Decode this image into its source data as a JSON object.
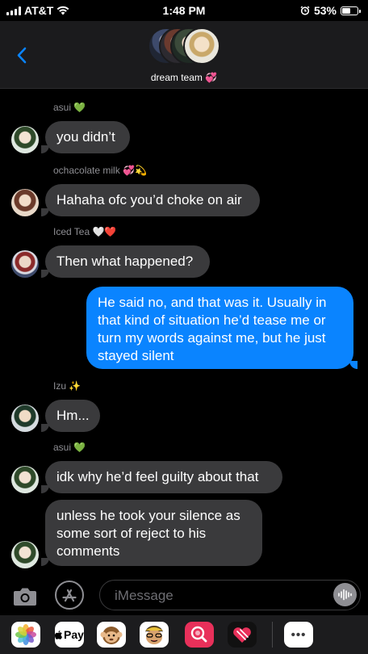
{
  "status_bar": {
    "carrier": "AT&T",
    "time": "1:48 PM",
    "battery": "53%",
    "battery_level": 0.53
  },
  "header": {
    "back_icon": "chevron-left-icon",
    "group_name": "dream team 💞"
  },
  "messages": [
    {
      "sender": "asui 💚",
      "text": "you didn’t",
      "direction": "incoming"
    },
    {
      "sender": "ochacolate milk 💞💫",
      "text": "Hahaha ofc you’d choke on air",
      "direction": "incoming"
    },
    {
      "sender": "Iced Tea 🤍❤️",
      "text": "Then what happened?",
      "direction": "incoming"
    },
    {
      "text": "He said no, and that was it. Usually in that kind of situation he’d tease me or turn my words against me, but he just stayed silent",
      "direction": "outgoing"
    },
    {
      "sender": "Izu ✨",
      "text": "Hm...",
      "direction": "incoming"
    },
    {
      "sender": "asui 💚",
      "text": "idk why he’d feel guilty about that",
      "direction": "incoming"
    },
    {
      "text": "unless he took your silence as some sort of reject to his comments",
      "direction": "incoming"
    }
  ],
  "input_bar": {
    "placeholder": "iMessage",
    "value": ""
  },
  "app_drawer": {
    "apps": [
      "photos-icon",
      "apple-pay-icon",
      "memoji-icon",
      "memoji-stickers-icon",
      "web-images-icon",
      "digital-touch-icon",
      "more-icon"
    ],
    "apple_pay_label": "Pay",
    "more_label": "•••"
  },
  "colors": {
    "background": "#000000",
    "incoming_bubble": "#3a3a3c",
    "outgoing_bubble": "#0a84ff",
    "accent": "#0a84ff"
  }
}
